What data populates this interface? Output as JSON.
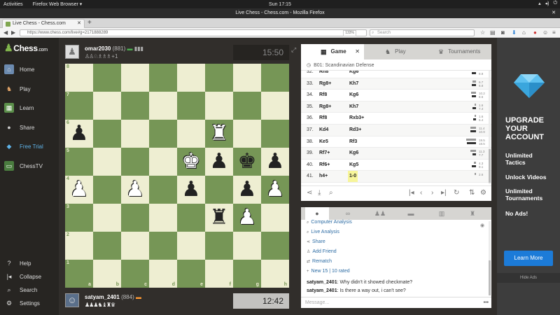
{
  "os": {
    "activities": "Activities",
    "browser_app": "Firefox Web Browser ▾",
    "clock": "Sun 17:15"
  },
  "window": {
    "title": "Live Chess - Chess.com - Mozilla Firefox"
  },
  "tab": {
    "label": "Live Chess - Chess.com"
  },
  "nav": {
    "url": "https://www.chess.com/live#g=2171888289",
    "zoom": "133%",
    "search_placeholder": "Search"
  },
  "sidebar": {
    "logo": "Chess",
    "logo_suffix": ".com",
    "items": [
      {
        "label": "Home",
        "icon": "home-icon"
      },
      {
        "label": "Play",
        "icon": "play-icon"
      },
      {
        "label": "Learn",
        "icon": "learn-icon"
      },
      {
        "label": "Share",
        "icon": "share-icon"
      },
      {
        "label": "Free Trial",
        "icon": "diamond-icon"
      },
      {
        "label": "ChessTV",
        "icon": "tv-icon"
      }
    ],
    "bottom": [
      {
        "label": "Help",
        "icon": "help-icon"
      },
      {
        "label": "Collapse",
        "icon": "collapse-icon"
      },
      {
        "label": "Search",
        "icon": "search-icon"
      },
      {
        "label": "Settings",
        "icon": "settings-icon"
      }
    ]
  },
  "top_player": {
    "name": "omar2030",
    "rating": "(881)",
    "captured": "♙♙♘♗♗♗",
    "plus": "+1",
    "clock": "15:50"
  },
  "bottom_player": {
    "name": "satyam_2401",
    "rating": "(884)",
    "captured": "♟♟♟♞♝♜♛",
    "clock": "12:42"
  },
  "board": {
    "ranks": [
      "8",
      "7",
      "6",
      "5",
      "4",
      "3",
      "2",
      "1"
    ],
    "files": [
      "a",
      "b",
      "c",
      "d",
      "e",
      "f",
      "g",
      "h"
    ],
    "pieces": [
      {
        "sq": "a6",
        "glyph": "♟",
        "color": "b"
      },
      {
        "sq": "f6",
        "glyph": "♜",
        "color": "w"
      },
      {
        "sq": "e5",
        "glyph": "♚",
        "color": "w"
      },
      {
        "sq": "f5",
        "glyph": "♟",
        "color": "b"
      },
      {
        "sq": "g5",
        "glyph": "♚",
        "color": "b"
      },
      {
        "sq": "h5",
        "glyph": "♟",
        "color": "b"
      },
      {
        "sq": "a4",
        "glyph": "♟",
        "color": "w"
      },
      {
        "sq": "c4",
        "glyph": "♟",
        "color": "w"
      },
      {
        "sq": "e4",
        "glyph": "♟",
        "color": "b"
      },
      {
        "sq": "g4",
        "glyph": "♟",
        "color": "b"
      },
      {
        "sq": "h4",
        "glyph": "♟",
        "color": "w"
      },
      {
        "sq": "f3",
        "glyph": "♜",
        "color": "b"
      },
      {
        "sq": "g3",
        "glyph": "♟",
        "color": "w"
      }
    ]
  },
  "panel": {
    "tabs": [
      {
        "label": "Game",
        "icon": "board-icon"
      },
      {
        "label": "Play",
        "icon": "play-icon"
      },
      {
        "label": "Tournaments",
        "icon": "trophy-icon"
      }
    ],
    "opening": "B01: Scandinavian Defense",
    "moves": [
      {
        "n": "32.",
        "w": "Rh8",
        "b": "Kg6",
        "t1": "",
        "t2": "8.8"
      },
      {
        "n": "33.",
        "w": "Rg8+",
        "b": "Kh7",
        "t1": "6.7",
        "t2": "8.8"
      },
      {
        "n": "34.",
        "w": "Rf8",
        "b": "Kg6",
        "t1": "10.2",
        "t2": "8.6"
      },
      {
        "n": "35.",
        "w": "Rg8+",
        "b": "Kh7",
        "t1": "1.6",
        "t2": "7.4"
      },
      {
        "n": "36.",
        "w": "Rf8",
        "b": "Rxb3+",
        "t1": "1.6",
        "t2": "6.4"
      },
      {
        "n": "37.",
        "w": "Kd4",
        "b": "Rd3+",
        "t1": "11.4",
        "t2": "10.9"
      },
      {
        "n": "38.",
        "w": "Ke5",
        "b": "Rf3",
        "t1": "19.5",
        "t2": "18.5"
      },
      {
        "n": "39.",
        "w": "Rf7+",
        "b": "Kg6",
        "t1": "11.3",
        "t2": "7.7"
      },
      {
        "n": "40.",
        "w": "Rf6+",
        "b": "Kg5",
        "t1": "4.3",
        "t2": "9.1"
      },
      {
        "n": "41.",
        "w": "h4+",
        "b": "1-0",
        "t1": "2.6",
        "t2": ""
      }
    ]
  },
  "chat": {
    "links": [
      "Computer Analysis",
      "Live Analysis",
      "Share",
      "Add Friend",
      "Rematch"
    ],
    "new_text": "New 15 | 10 rated",
    "messages": [
      {
        "user": "satyam_2401",
        "text": ": Why didn't it showed checkmate?"
      },
      {
        "user": "satyam_2401",
        "text": ": Is there a way out, i can't see?"
      }
    ],
    "placeholder": "Message..."
  },
  "ad": {
    "headline": [
      "UPGRADE",
      "YOUR",
      "ACCOUNT"
    ],
    "lines": [
      [
        "Unlimited",
        "Tactics"
      ],
      [
        "Unlock Videos"
      ],
      [
        "Unlimited",
        "Tournaments"
      ],
      [
        "No Ads!"
      ]
    ],
    "button": "Learn More",
    "hide": "Hide Ads"
  },
  "colors": {
    "light_square": "#eeeed2",
    "dark_square": "#769656",
    "sidebar": "#272522",
    "accent_blue": "#1c7bd8",
    "highlight": "#f7f59a"
  }
}
